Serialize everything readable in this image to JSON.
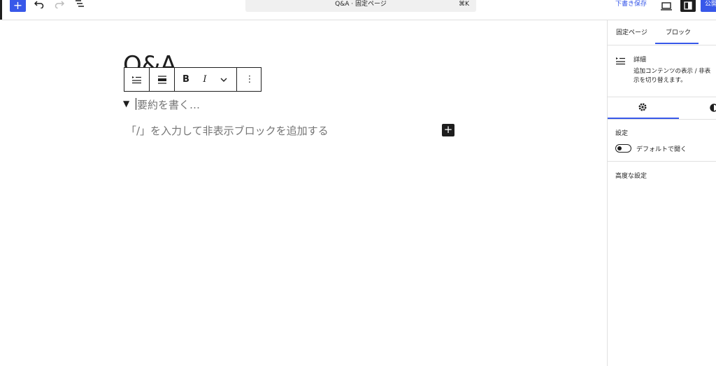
{
  "header": {
    "add_block_label": "+",
    "document_title": "Q&A · 固定ページ",
    "shortcut": "⌘K",
    "save_draft": "下書き保存",
    "publish": "公開"
  },
  "sidebar": {
    "tabs": [
      {
        "label": "固定ページ",
        "active": false
      },
      {
        "label": "ブロック",
        "active": true
      }
    ],
    "block_card": {
      "title": "詳細",
      "description": "追加コンテンツの表示 / 非表示を切り替えます。"
    },
    "settings_heading": "設定",
    "toggle": {
      "label": "デフォルトで開く",
      "checked": false
    },
    "advanced_heading": "高度な設定"
  },
  "editor": {
    "post_title": "Q&A",
    "summary_placeholder": "要約を書く…",
    "inner_placeholder": "「/」を入力して非表示ブロックを追加する",
    "inserter_label": "+",
    "toolbar": {
      "bold": "B",
      "italic": "I",
      "more": "⋮"
    }
  },
  "colors": {
    "accent": "#3858e9",
    "dark": "#1e1e1e",
    "placeholder": "#757575"
  }
}
